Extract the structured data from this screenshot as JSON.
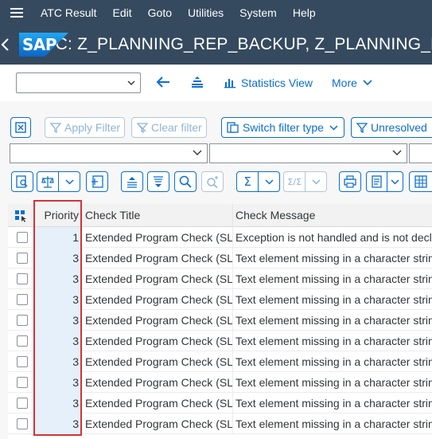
{
  "menu": {
    "items": [
      {
        "name": "menu-atc-result",
        "label": "ATC Result"
      },
      {
        "name": "menu-edit",
        "label": "Edit"
      },
      {
        "name": "menu-goto",
        "label": "Goto"
      },
      {
        "name": "menu-utilities",
        "label": "Utilities"
      },
      {
        "name": "menu-system",
        "label": "System"
      },
      {
        "name": "menu-help",
        "label": "Help"
      }
    ]
  },
  "header": {
    "logo_text": "SAP",
    "title": "ATC:  Z_PLANNING_REP_BACKUP, Z_PLANNING_REP_BACKUP"
  },
  "toolbar": {
    "dropdown_value": "",
    "statistics_label": "Statistics View",
    "more_label": "More"
  },
  "filterbar": {
    "apply_filter": "Apply Filter",
    "clear_filter": "Clear filter",
    "switch_filter_type": "Switch filter type",
    "unresolved": "Unresolved"
  },
  "table": {
    "columns": {
      "priority": "Priority",
      "check_title": "Check Title",
      "check_message": "Check Message"
    },
    "rows": [
      {
        "priority": "1",
        "check_title": "Extended Program Check (SLIN)",
        "check_message": "Exception is not handled and is not declared"
      },
      {
        "priority": "3",
        "check_title": "Extended Program Check (SLIN)",
        "check_message": "Text element missing in a character string"
      },
      {
        "priority": "3",
        "check_title": "Extended Program Check (SLIN)",
        "check_message": "Text element missing in a character string"
      },
      {
        "priority": "3",
        "check_title": "Extended Program Check (SLIN)",
        "check_message": "Text element missing in a character string"
      },
      {
        "priority": "3",
        "check_title": "Extended Program Check (SLIN)",
        "check_message": "Text element missing in a character string"
      },
      {
        "priority": "3",
        "check_title": "Extended Program Check (SLIN)",
        "check_message": "Text element missing in a character string"
      },
      {
        "priority": "3",
        "check_title": "Extended Program Check (SLIN)",
        "check_message": "Text element missing in a character string"
      },
      {
        "priority": "3",
        "check_title": "Extended Program Check (SLIN)",
        "check_message": "Text element missing in a character string"
      },
      {
        "priority": "3",
        "check_title": "Extended Program Check (SLIN)",
        "check_message": "Text element missing in a character string"
      },
      {
        "priority": "3",
        "check_title": "Extended Program Check (SLIN)",
        "check_message": "Text element missing in a character string"
      }
    ]
  },
  "colors": {
    "shell": "#354a5f",
    "accent": "#0a6ed1",
    "highlight": "#d0343a",
    "priority_column_bg": "#e5f0fa"
  }
}
